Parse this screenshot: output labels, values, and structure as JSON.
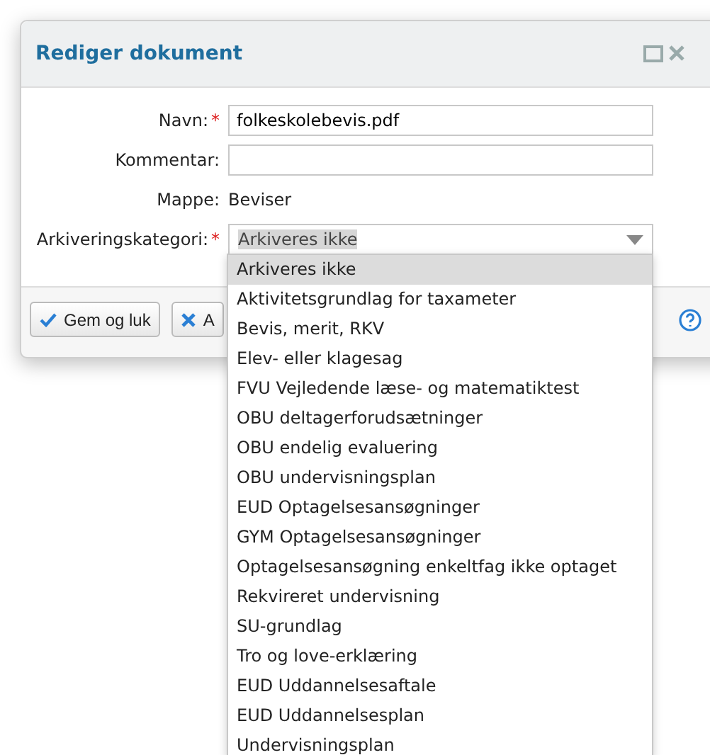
{
  "dialog": {
    "title": "Rediger dokument"
  },
  "fields": [
    {
      "kind": "input",
      "label": "Navn:",
      "required_mark": "*",
      "value": "folkeskolebevis.pdf"
    },
    {
      "kind": "input",
      "label": "Kommentar:"
    },
    {
      "kind": "text",
      "label": "Mappe:",
      "value": "Beviser"
    },
    {
      "kind": "select",
      "label": "Arkiveringskategori:",
      "required_mark": "*",
      "value": "Arkiveres ikke",
      "expanded": true
    }
  ],
  "buttons": [
    {
      "kind": "save",
      "label": "Gem og luk"
    },
    {
      "kind": "cancel",
      "label": "A"
    }
  ],
  "dropdown": {
    "options": [
      {
        "label": "Arkiveres ikke",
        "selected": true
      },
      {
        "label": "Aktivitetsgrundlag for taxameter",
        "selected": false
      },
      {
        "label": "Bevis, merit, RKV",
        "selected": false
      },
      {
        "label": "Elev- eller klagesag",
        "selected": false
      },
      {
        "label": "FVU Vejledende læse- og matematiktest",
        "selected": false
      },
      {
        "label": "OBU deltagerforudsætninger",
        "selected": false
      },
      {
        "label": "OBU endelig evaluering",
        "selected": false
      },
      {
        "label": "OBU undervisningsplan",
        "selected": false
      },
      {
        "label": "EUD Optagelsesansøgninger",
        "selected": false
      },
      {
        "label": "GYM Optagelsesansøgninger",
        "selected": false
      },
      {
        "label": "Optagelsesansøgning enkeltfag ikke optaget",
        "selected": false
      },
      {
        "label": "Rekvireret undervisning",
        "selected": false
      },
      {
        "label": "SU-grundlag",
        "selected": false
      },
      {
        "label": "Tro og love-erklæring",
        "selected": false
      },
      {
        "label": "EUD Uddannelsesaftale",
        "selected": false
      },
      {
        "label": "EUD Uddannelsesplan",
        "selected": false
      },
      {
        "label": "Undervisningsplan",
        "selected": false
      }
    ]
  }
}
